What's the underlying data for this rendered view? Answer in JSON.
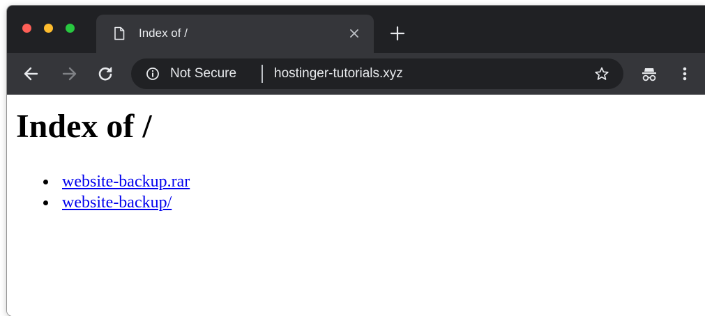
{
  "browser": {
    "tab": {
      "title": "Index of /",
      "icon": "document-icon"
    },
    "toolbar": {
      "security_label": "Not Secure",
      "url": "hostinger-tutorials.xyz"
    },
    "icons": {
      "back": "back-arrow-icon",
      "forward": "forward-arrow-icon",
      "reload": "reload-icon",
      "info": "info-icon",
      "bookmark": "star-icon",
      "incognito": "incognito-icon",
      "menu": "kebab-menu-icon",
      "new_tab": "plus-icon",
      "close_tab": "close-icon"
    },
    "colors": {
      "tab_strip": "#202124",
      "toolbar": "#35363a",
      "link": "#0000ee"
    }
  },
  "page": {
    "heading": "Index of /",
    "files": [
      {
        "label": "website-backup.rar"
      },
      {
        "label": "website-backup/"
      }
    ]
  }
}
